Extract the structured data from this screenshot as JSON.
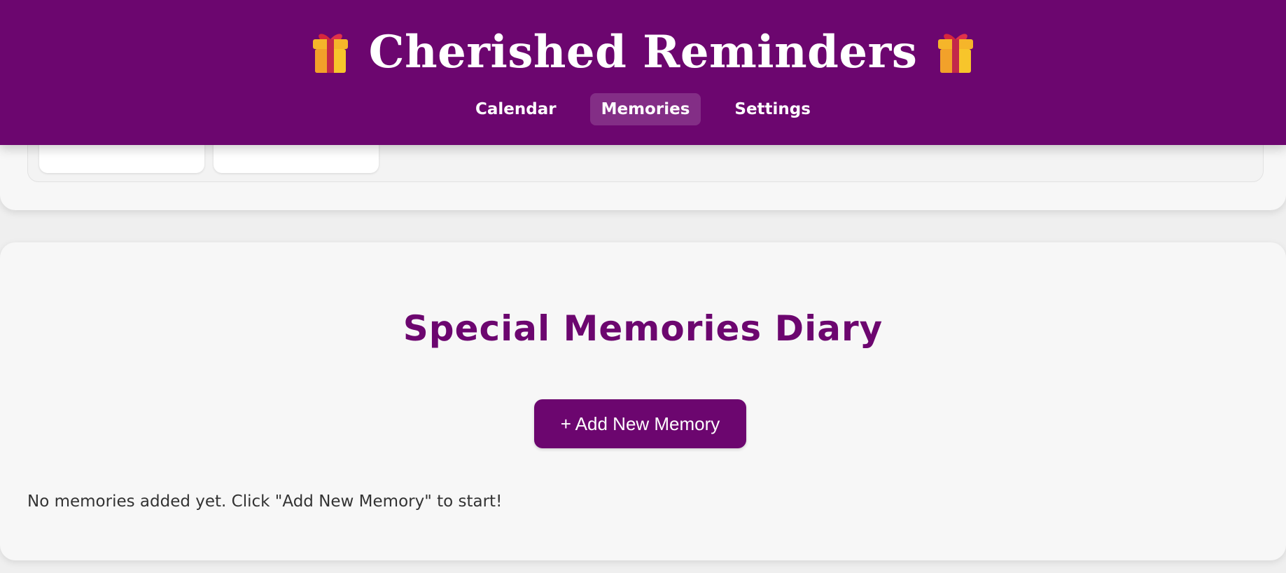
{
  "header": {
    "title": "Cherished Reminders",
    "nav": [
      {
        "label": "Calendar"
      },
      {
        "label": "Memories"
      },
      {
        "label": "Settings"
      }
    ],
    "active_tab": "Memories"
  },
  "memories": {
    "title": "Special Memories Diary",
    "add_button_label": "+ Add New Memory",
    "empty_message": "No memories added yet. Click \"Add New Memory\" to start!"
  },
  "colors": {
    "brand": "#6c066f",
    "panel": "#f7f7f7",
    "text": "#333333"
  },
  "icons": {
    "title_left": "gift-icon",
    "title_right": "gift-icon"
  }
}
